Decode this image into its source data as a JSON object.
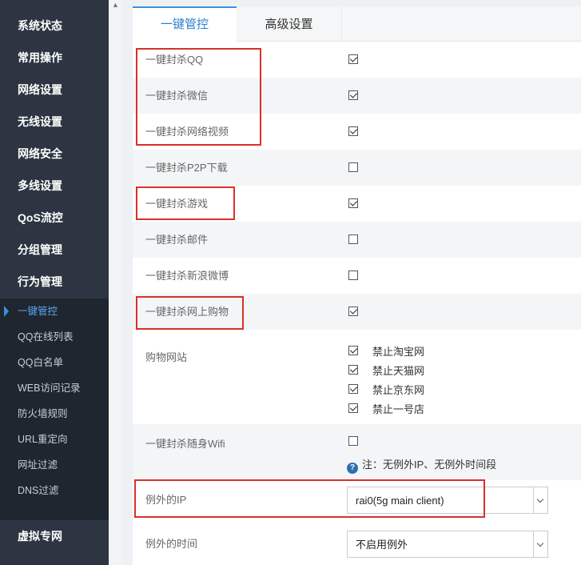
{
  "sidebar": {
    "main_items": [
      "系统状态",
      "常用操作",
      "网络设置",
      "无线设置",
      "网络安全",
      "多线设置",
      "QoS流控",
      "分组管理",
      "行为管理"
    ],
    "sub_items": [
      "一键管控",
      "QQ在线列表",
      "QQ白名单",
      "WEB访问记录",
      "防火墙规则",
      "URL重定向",
      "网址过滤",
      "DNS过滤"
    ],
    "active_sub": "一键管控",
    "bottom_item": "虚拟专网"
  },
  "tabs": [
    {
      "label": "一键管控",
      "active": true
    },
    {
      "label": "高级设置",
      "active": false
    }
  ],
  "settings": [
    {
      "label": "一键封杀QQ",
      "checked": true
    },
    {
      "label": "一键封杀微信",
      "checked": true
    },
    {
      "label": "一键封杀网络视频",
      "checked": true
    },
    {
      "label": "一键封杀P2P下载",
      "checked": false
    },
    {
      "label": "一键封杀游戏",
      "checked": true
    },
    {
      "label": "一键封杀邮件",
      "checked": false
    },
    {
      "label": "一键封杀新浪微博",
      "checked": false
    },
    {
      "label": "一键封杀网上购物",
      "checked": true
    }
  ],
  "shopping": {
    "label": "购物网站",
    "sites": [
      {
        "label": "禁止淘宝网",
        "checked": true
      },
      {
        "label": "禁止天猫网",
        "checked": true
      },
      {
        "label": "禁止京东网",
        "checked": true
      },
      {
        "label": "禁止一号店",
        "checked": true
      }
    ]
  },
  "wifi": {
    "label": "一键封杀随身Wifi",
    "checked": false,
    "note": "注：无例外IP、无例外时间段"
  },
  "exception_ip": {
    "label": "例外的IP",
    "value": "rai0(5g main client)"
  },
  "exception_time": {
    "label": "例外的时间",
    "value": "不启用例外"
  },
  "colors": {
    "highlight": "#d9302a",
    "accent": "#3b8fe0",
    "sidebar": "#2c3541"
  }
}
